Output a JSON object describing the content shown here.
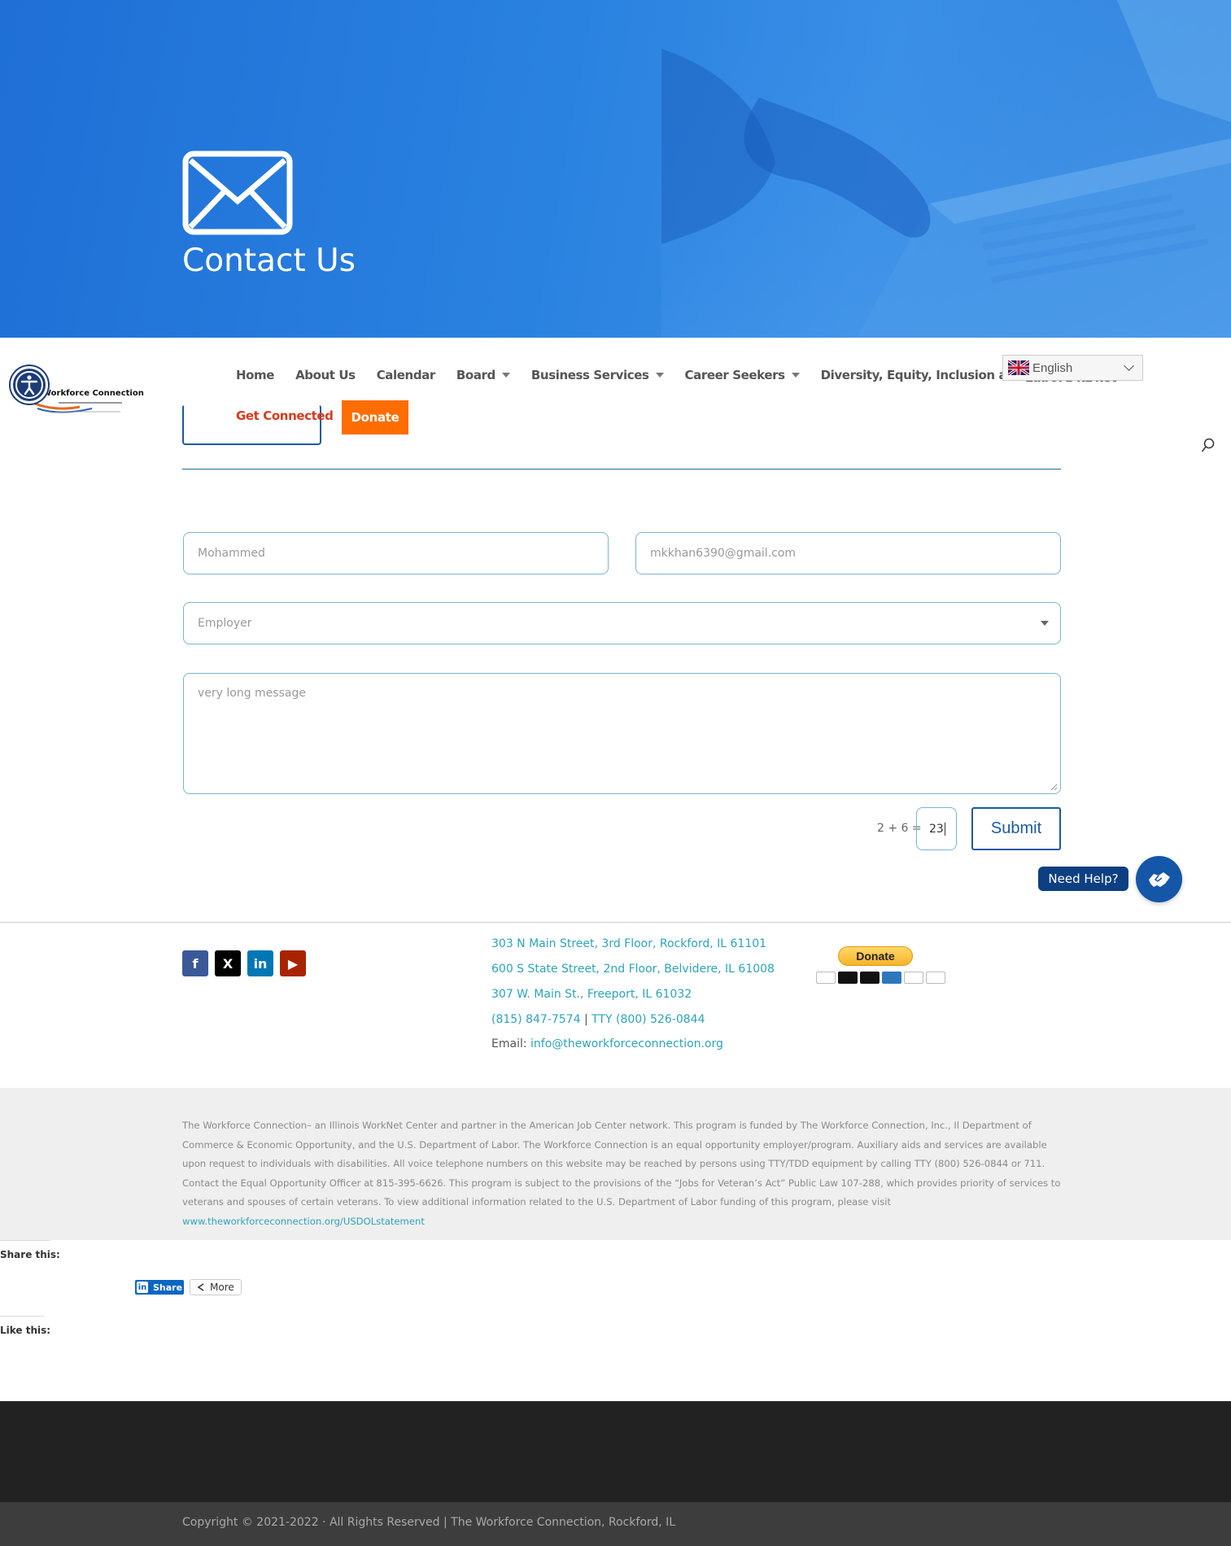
{
  "hero": {
    "title": "Contact Us"
  },
  "nav": {
    "items": [
      {
        "label": "Home",
        "dropdown": false
      },
      {
        "label": "About Us",
        "dropdown": false
      },
      {
        "label": "Calendar",
        "dropdown": false
      },
      {
        "label": "Board",
        "dropdown": true
      },
      {
        "label": "Business Services",
        "dropdown": true
      },
      {
        "label": "Career Seekers",
        "dropdown": true
      },
      {
        "label": "Diversity, Equity, Inclusion and Belonging",
        "dropdown": false
      }
    ],
    "hidden_item": "Labor Market",
    "get_connected": "Get Connected",
    "donate": "Donate",
    "language": "English"
  },
  "logo": {
    "text": "Workforce Connection"
  },
  "form": {
    "name_value": "Mohammed",
    "email_value": "mkkhan6390@gmail.com",
    "employer_value": "Employer",
    "message_value": "very long message",
    "captcha_label": "2 + 6 =",
    "captcha_value": "23",
    "submit_label": "Submit"
  },
  "help": {
    "label": "Need Help?"
  },
  "footer": {
    "social": [
      "f",
      "X",
      "in",
      "▶"
    ],
    "address_1": "303 N Main Street, 3rd Floor, Rockford, IL 61101",
    "address_2": "600 S State Street, 2nd Floor, Belvidere, IL 61008",
    "address_3": "307 W. Main St., Freeport, IL 61032",
    "phone": "(815) 847-7574",
    "phone_sep": " | ",
    "tty": "TTY (800) 526-0844",
    "email_label": "Email: ",
    "email": "info@theworkforceconnection.org",
    "paypal_donate": "Donate",
    "card_colors": [
      "#ffffff",
      "#eb001b",
      "#0099df",
      "#2e77bc",
      "#f68121",
      "#e21836"
    ]
  },
  "notice": {
    "text": "The Workforce Connection– an Illinois WorkNet Center and partner in the American Job Center network. This program is funded by The Workforce Connection, Inc., Il Department of Commerce & Economic Opportunity, and the U.S. Department of Labor. The Workforce Connection is an equal opportunity employer/program. Auxiliary aids and services are available upon request to individuals with disabilities. All voice telephone numbers on this website may be reached by persons using TTY/TDD equipment by calling TTY (800) 526-0844 or 711. Contact the Equal Opportunity Officer at 815-395-6626. This program is subject to the provisions of the “Jobs for Veteran’s Act” Public Law 107-288, which provides priority of services to veterans and spouses of certain veterans. To view additional information related to the U.S. Department of Labor funding of this program, please visit ",
    "link": "www.theworkforceconnection.org/USDOLstatement"
  },
  "share": {
    "label": "Share this:",
    "linkedin": "Share",
    "more": "More"
  },
  "like": {
    "label": "Like this:"
  },
  "copyright": "Copyright © 2021-2022 · All Rights Reserved | The Workforce Connection, Rockford, IL"
}
